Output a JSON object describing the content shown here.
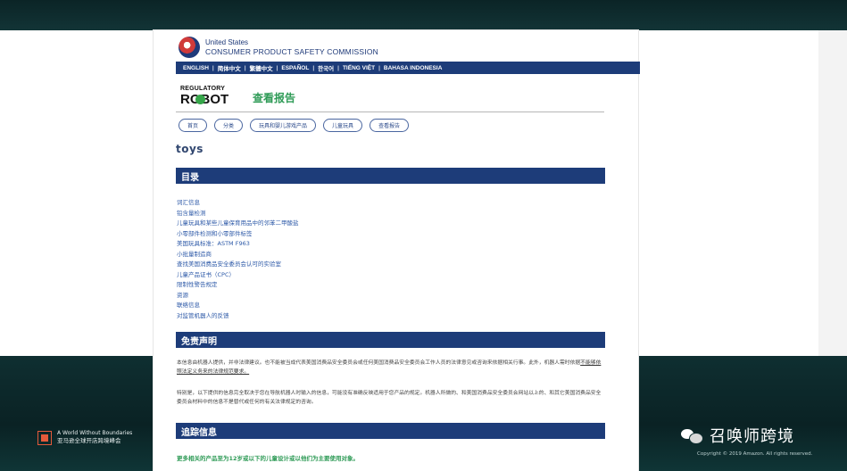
{
  "header": {
    "agency_line1": "United States",
    "agency_line2": "CONSUMER PRODUCT SAFETY COMMISSION"
  },
  "languages": [
    "ENGLISH",
    "简体中文",
    "繁體中文",
    "ESPAÑOL",
    "한국어",
    "TIẾNG VIỆT",
    "BAHASA INDONESIA"
  ],
  "robot_logo": {
    "top": "REGULATORY",
    "bottom": "ROBOT"
  },
  "report_title": "查看报告",
  "nav_pills": [
    "首页",
    "分类",
    "玩具和婴儿游戏产品",
    "儿童玩具",
    "查看报告"
  ],
  "product_term": "toys",
  "sections": {
    "toc_title": "目录",
    "disclaimer_title": "免责声明",
    "trace_title": "追踪信息"
  },
  "toc_items": [
    "词汇信息",
    "铅含量检测",
    "儿童玩具和某些儿童保育用品中的邻苯二甲酸盐",
    "小零部件检测和小零部件标签",
    "美国玩具标准：ASTM F963",
    "小批量制造商",
    "查找美国消费品安全委员会认可的实验室",
    "儿童产品证书（CPC）",
    "限制性警告规定",
    "资源",
    "联络信息",
    "对监管机器人的反馈"
  ],
  "disclaimer_p1": "本信息由机器人提供，并非法律建议。也不能被当成代表美国消费品安全委员会或任何美国消费品安全委员会工作人员的法律意见或咨询来依据相关行事。此外，机器人需时依据",
  "disclaimer_p1_underlined": "不能够依照法定义务来的法律规范要求。",
  "disclaimer_p2": "特别是，以下提供的信息完全取决于您在导航机器人时输入的信息，可能没有准确反映适用于您产品的规定。机器人所做的、和美国消费品安全委员会网站以上的、和其它美国消费品安全委员会材料中的信息不是替代或任何的有关法律规定的咨询。",
  "trace_link": "更多相关的产品至为12岁或以下的儿童设计或以他们为主要使用对象。",
  "overlay": {
    "amazon_line1": "A World Without Boundaries",
    "amazon_line2": "亚马逊全球开店跨境峰会",
    "watermark": "召唤师跨境",
    "copyright": "Copyright © 2019 Amazon. All rights reserved."
  },
  "colors": {
    "navy": "#1d3c79",
    "green": "#2f9b57",
    "link_blue": "#2e5aa8"
  }
}
